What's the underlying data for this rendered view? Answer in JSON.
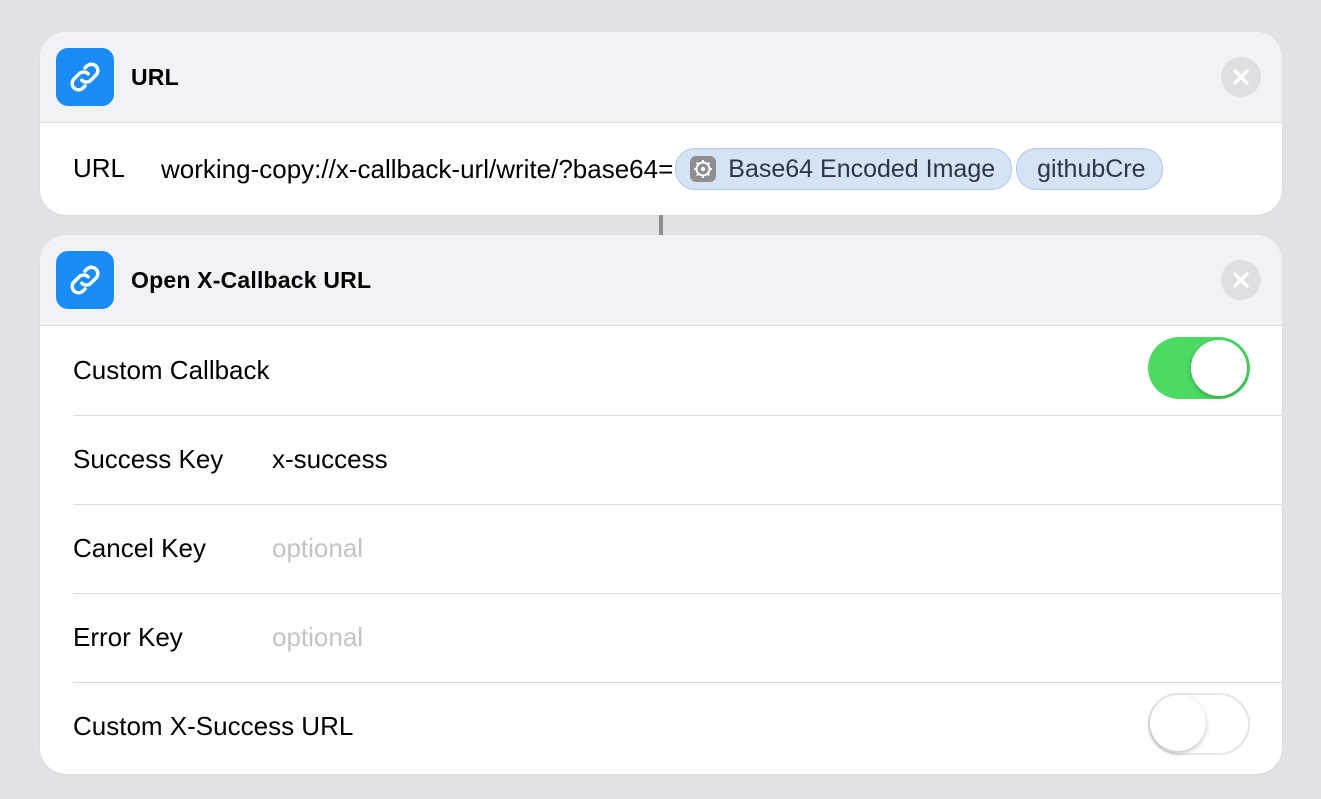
{
  "url_action": {
    "title": "URL",
    "field_label": "URL",
    "url_text": "working-copy://x-callback-url/write/?base64=",
    "tokens": [
      {
        "label": "Base64 Encoded Image",
        "icon": "gear-icon"
      },
      {
        "label": "githubCre"
      }
    ]
  },
  "callback_action": {
    "title": "Open X-Callback URL",
    "rows": {
      "custom_callback": {
        "label": "Custom Callback",
        "toggle": "on"
      },
      "success_key": {
        "label": "Success Key",
        "value": "x-success"
      },
      "cancel_key": {
        "label": "Cancel Key",
        "placeholder": "optional"
      },
      "error_key": {
        "label": "Error Key",
        "placeholder": "optional"
      },
      "custom_success_url": {
        "label": "Custom X-Success URL",
        "toggle": "off"
      }
    }
  },
  "colors": {
    "accent": "#1a8cf5",
    "toggle_on": "#4cd964",
    "token_bg": "#d6e3f7",
    "background": "#e1e2e6"
  }
}
